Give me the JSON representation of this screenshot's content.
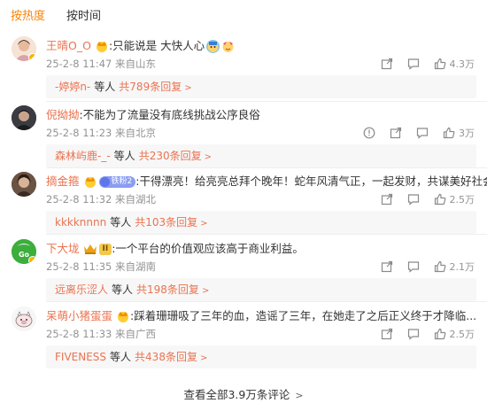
{
  "tabs": [
    {
      "label": "按热度",
      "active": true
    },
    {
      "label": "按时间",
      "active": false
    }
  ],
  "comments": [
    {
      "username": "王晴O_O",
      "text": ":只能说是 大快人心",
      "time": "25-2-8 11:47",
      "location": "来自山东",
      "likes": "4.3万",
      "reply_user": "-婷婷n-",
      "reply_mid": "等人",
      "reply_count": "共789条回复",
      "avatar_color": "#f2d7c4"
    },
    {
      "username": "倪拗拗",
      "text": ":不能为了流量没有底线挑战公序良俗",
      "time": "25-2-8 11:23",
      "location": "来自北京",
      "likes": "3万",
      "reply_user": "森林屿鹿-_-",
      "reply_mid": "等人",
      "reply_count": "共230条回复",
      "avatar_color": "#2f2f35"
    },
    {
      "username": "摘金箍",
      "badge": "铁粉2",
      "text": ":干得漂亮！给亮亮总拜个晚年！蛇年风清气正，一起发财，共谋美好社会！",
      "time": "25-2-8 11:32",
      "location": "来自湖北",
      "likes": "2.5万",
      "reply_user": "kkkknnnn",
      "reply_mid": "等人",
      "reply_count": "共103条回复",
      "avatar_color": "#5a4233"
    },
    {
      "username": "下大垅",
      "badge": "II",
      "text": ":一个平台的价值观应该高于商业利益。",
      "time": "25-2-8 11:35",
      "location": "来自湖南",
      "likes": "2.1万",
      "reply_user": "远离乐涩人",
      "reply_mid": "等人",
      "reply_count": "共198条回复",
      "avatar_color": "#3cae3c"
    },
    {
      "username": "呆萌小猪蛋蛋",
      "text": ":踩着珊珊吸了三年的血，造谣了三年，在她走了之后正义终于才降临...",
      "time": "25-2-8 11:33",
      "location": "来自广西",
      "likes": "2.5万",
      "reply_user": "FIVENESS",
      "reply_mid": "等人",
      "reply_count": "共438条回复",
      "avatar_color": "#f4f4f4"
    }
  ],
  "footer": {
    "label": "查看全部3.9万条评论"
  },
  "colors": {
    "accent": "#ff8200",
    "link": "#eb7350",
    "meta": "#939393"
  }
}
